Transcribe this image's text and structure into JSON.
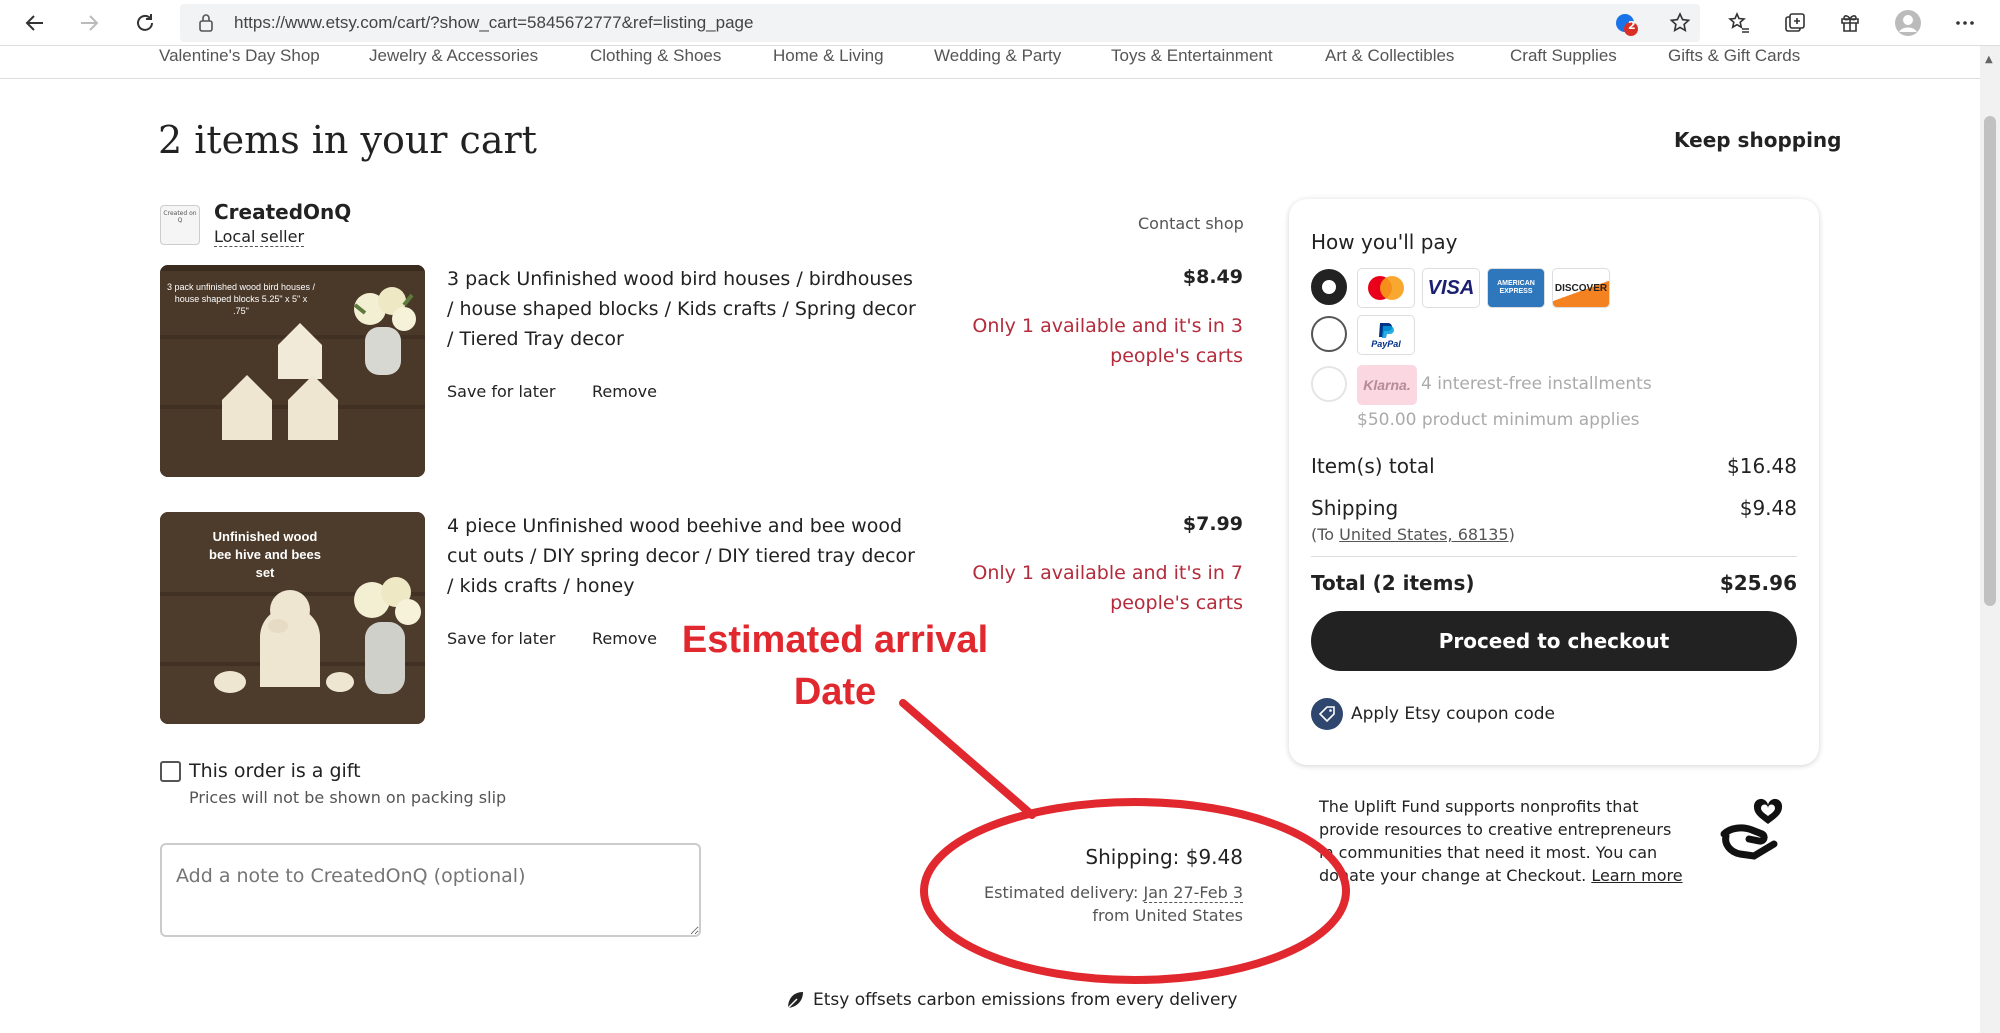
{
  "browser": {
    "url": "https://www.etsy.com/cart/?show_cart=5845672777&ref=listing_page",
    "badge_count": "2"
  },
  "categories": [
    "Valentine's Day Shop",
    "Jewelry & Accessories",
    "Clothing & Shoes",
    "Home & Living",
    "Wedding & Party",
    "Toys & Entertainment",
    "Art & Collectibles",
    "Craft Supplies",
    "Gifts & Gift Cards"
  ],
  "page": {
    "title": "2 items in your cart",
    "keep_shopping": "Keep shopping"
  },
  "shop": {
    "name": "CreatedOnQ",
    "badge": "Local seller",
    "contact": "Contact shop",
    "logo_text": "Created on Q"
  },
  "items": [
    {
      "title": "3 pack Unfinished wood bird houses / birdhouses / house shaped blocks / Kids crafts / Spring decor / Tiered Tray decor",
      "price": "$8.49",
      "warning": "Only 1 available and it's in 3 people's carts",
      "save": "Save for later",
      "remove": "Remove",
      "image_text": "3 pack unfinished wood bird houses / house shaped blocks 5.25\" x 5\" x .75\""
    },
    {
      "title": "4 piece Unfinished wood beehive and bee wood cut outs / DIY spring decor / DIY tiered tray decor / kids crafts / honey",
      "price": "$7.99",
      "warning": "Only 1 available and it's in 7 people's carts",
      "save": "Save for later",
      "remove": "Remove",
      "image_text": "Unfinished wood bee hive and bees set"
    }
  ],
  "gift": {
    "label": "This order is a gift",
    "sub": "Prices will not be shown on packing slip"
  },
  "note": {
    "placeholder": "Add a note to CreatedOnQ (optional)"
  },
  "shipping": {
    "line": "Shipping: $9.48",
    "est_prefix": "Estimated delivery:",
    "est_date": "Jan 27-Feb 3",
    "origin": "from United States"
  },
  "carbon": "Etsy offsets carbon emissions from every delivery",
  "payment": {
    "heading": "How you'll pay",
    "cards": [
      "VISA",
      "AMERICAN EXPRESS",
      "DISCOVER"
    ],
    "paypal": "PayPal",
    "klarna": "Klarna.",
    "klarna_text": "4 interest-free installments",
    "klarna_sub": "$50.00 product minimum applies",
    "items_total_label": "Item(s) total",
    "items_total": "$16.48",
    "shipping_label": "Shipping",
    "shipping_value": "$9.48",
    "to_prefix": "(To ",
    "to_location": "United States, 68135",
    "to_suffix": ")",
    "total_label": "Total (2 items)",
    "total_value": "$25.96",
    "checkout": "Proceed to checkout",
    "coupon": "Apply Etsy coupon code"
  },
  "uplift": {
    "text": "The Uplift Fund supports nonprofits that provide resources to creative entrepreneurs in communities that need it most. You can donate your change at Checkout.",
    "link": "Learn more"
  },
  "annotation": {
    "line1": "Estimated arrival",
    "line2": "Date",
    "color": "#e0282e"
  },
  "colors": {
    "warning": "#b42b3b",
    "button": "#222222",
    "coupon_icon": "#2f466e"
  }
}
